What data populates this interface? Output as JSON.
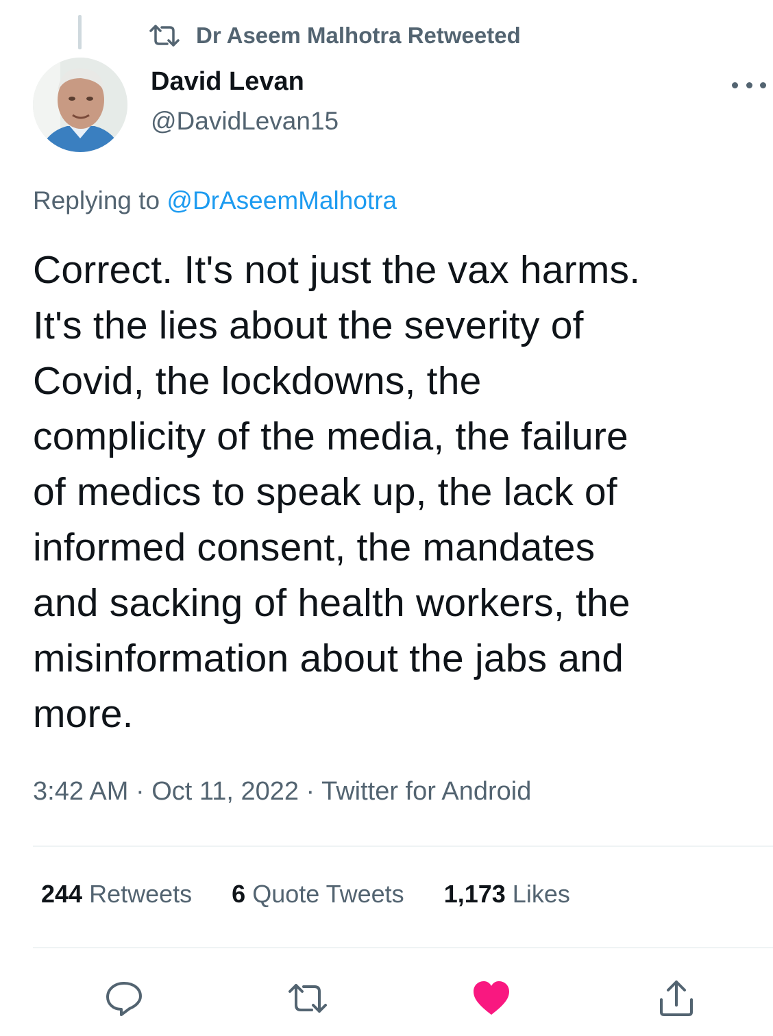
{
  "retweet_banner": {
    "text": "Dr Aseem Malhotra Retweeted",
    "icon": "retweet-icon"
  },
  "author": {
    "name": "David Levan",
    "handle": "@DavidLevan15",
    "avatar": "avatar-photo"
  },
  "reply": {
    "prefix": "Replying to ",
    "mention": "@DrAseemMalhotra"
  },
  "tweet": {
    "lines": [
      "Correct. It's not just the vax harms.",
      "It's the lies about the severity of",
      "Covid, the lockdowns, the",
      "complicity of the media, the failure",
      "of medics to speak up, the lack of",
      "informed consent, the mandates",
      "and sacking of health workers, the",
      "misinformation about the jabs and",
      "more."
    ]
  },
  "meta": {
    "time": "3:42 AM",
    "separator": " · ",
    "date": "Oct 11, 2022",
    "client": "Twitter for Android"
  },
  "stats": {
    "retweets_count": "244",
    "retweets_label": "Retweets",
    "quotes_count": "6",
    "quotes_label": "Quote Tweets",
    "likes_count": "1,173",
    "likes_label": "Likes"
  },
  "actions": {
    "reply_icon": "reply-icon",
    "retweet_icon": "retweet-icon",
    "like_icon": "heart-icon",
    "share_icon": "share-icon",
    "like_color": "#f91880",
    "icon_color": "#536471"
  },
  "colors": {
    "link": "#1d9bf0",
    "muted": "#536471",
    "text": "#0f1419"
  }
}
